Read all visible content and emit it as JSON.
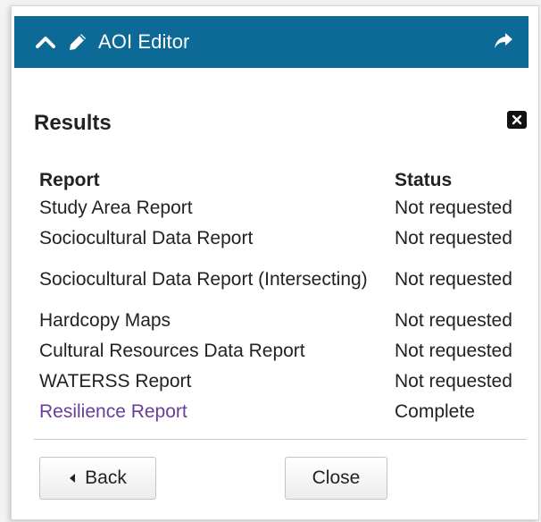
{
  "header": {
    "title": "AOI Editor",
    "background_color": "#0d6a97",
    "icons": {
      "collapse": "chevron-up-icon",
      "edit": "pencil-icon",
      "share": "share-arrow-icon"
    }
  },
  "results": {
    "title": "Results",
    "close_icon": "close-icon"
  },
  "table": {
    "headers": {
      "report": "Report",
      "status": "Status"
    },
    "rows": [
      {
        "report": "Study Area Report",
        "status": "Not requested",
        "is_link": false
      },
      {
        "report": "Sociocultural Data Report",
        "status": "Not requested",
        "is_link": false
      },
      {
        "report": "Sociocultural Data Report (Intersecting)",
        "status": "Not requested",
        "is_link": false
      },
      {
        "report": "Hardcopy Maps",
        "status": "Not requested",
        "is_link": false
      },
      {
        "report": "Cultural Resources Data Report",
        "status": "Not requested",
        "is_link": false
      },
      {
        "report": "WATERSS Report",
        "status": "Not requested",
        "is_link": false
      },
      {
        "report": "Resilience Report",
        "status": "Complete",
        "is_link": true
      }
    ],
    "link_color": "#6a3d9a"
  },
  "footer": {
    "back_label": "Back",
    "close_label": "Close"
  }
}
